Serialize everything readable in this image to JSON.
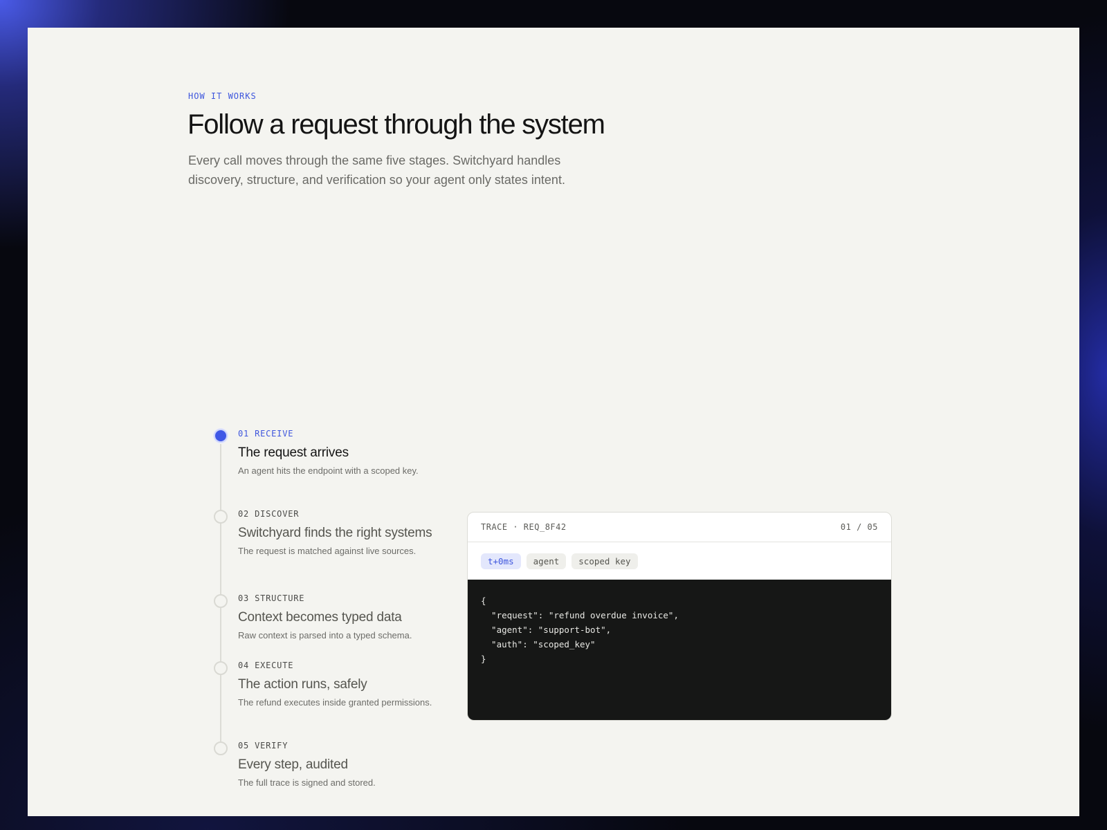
{
  "section": {
    "eyebrow": "HOW IT WORKS",
    "title": "Follow a request through the system",
    "subtitle": "Every call moves through the same five stages. Switchyard handles discovery, structure, and verification so your agent only states intent."
  },
  "steps": [
    {
      "label": "01 RECEIVE",
      "title": "The request arrives",
      "description": "An agent hits the endpoint with a scoped key.",
      "active": true
    },
    {
      "label": "02 DISCOVER",
      "title": "Switchyard finds the right systems",
      "description": "The request is matched against live sources.",
      "active": false
    },
    {
      "label": "03 STRUCTURE",
      "title": "Context becomes typed data",
      "description": "Raw context is parsed into a typed schema.",
      "active": false
    },
    {
      "label": "04 EXECUTE",
      "title": "The action runs, safely",
      "description": "The refund executes inside granted permissions.",
      "active": false
    },
    {
      "label": "05 VERIFY",
      "title": "Every step, audited",
      "description": "The full trace is signed and stored.",
      "active": false
    }
  ],
  "trace": {
    "header": "TRACE · REQ_8F42",
    "counter": "01 / 05",
    "chips": [
      "t+0ms",
      "agent",
      "scoped key"
    ],
    "code": [
      "{",
      "  \"request\": \"refund overdue invoice\",",
      "  \"agent\": \"support-bot\",",
      "  \"auth\": \"scoped_key\"",
      "}"
    ]
  },
  "colors": {
    "accent": "#3f57e6",
    "page_background": "#f4f4f0",
    "code_background": "#161716"
  }
}
